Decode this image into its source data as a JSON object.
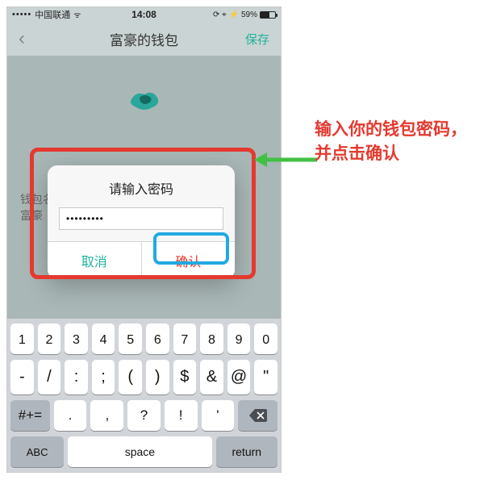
{
  "status": {
    "signal": "•••••",
    "carrier": "中国联通",
    "wifi": "ᯤ",
    "time": "14:08",
    "icons": "⟳ ⌖ ⚡",
    "battery_pct": "59%"
  },
  "nav": {
    "back_glyph": "‹",
    "title": "富豪的钱包",
    "save": "保存"
  },
  "bg_fields": {
    "line1": "钱包名",
    "line2": "富豪"
  },
  "dialog": {
    "title": "请输入密码",
    "password_value": "•••••••••",
    "cancel": "取消",
    "ok": "确认"
  },
  "keyboard": {
    "row1": [
      {
        "n": "1",
        "s": ""
      },
      {
        "n": "2",
        "s": ""
      },
      {
        "n": "3",
        "s": ""
      },
      {
        "n": "4",
        "s": ""
      },
      {
        "n": "5",
        "s": ""
      },
      {
        "n": "6",
        "s": ""
      },
      {
        "n": "7",
        "s": ""
      },
      {
        "n": "8",
        "s": ""
      },
      {
        "n": "9",
        "s": ""
      },
      {
        "n": "0",
        "s": ""
      }
    ],
    "row2": [
      "-",
      "/",
      ":",
      ";",
      "(",
      ")",
      "$",
      "&",
      "@",
      "\""
    ],
    "row3_switch": "#+=",
    "row3": [
      ".",
      ",",
      "?",
      "!",
      "'"
    ],
    "row4": {
      "abc": "ABC",
      "space": "space",
      "ret": "return"
    }
  },
  "annotation": {
    "text": "输入你的钱包密码，并点击确认"
  },
  "colors": {
    "accent_green": "#1fb39b",
    "accent_red": "#e4392f",
    "anno_blue": "#22a9e0"
  }
}
